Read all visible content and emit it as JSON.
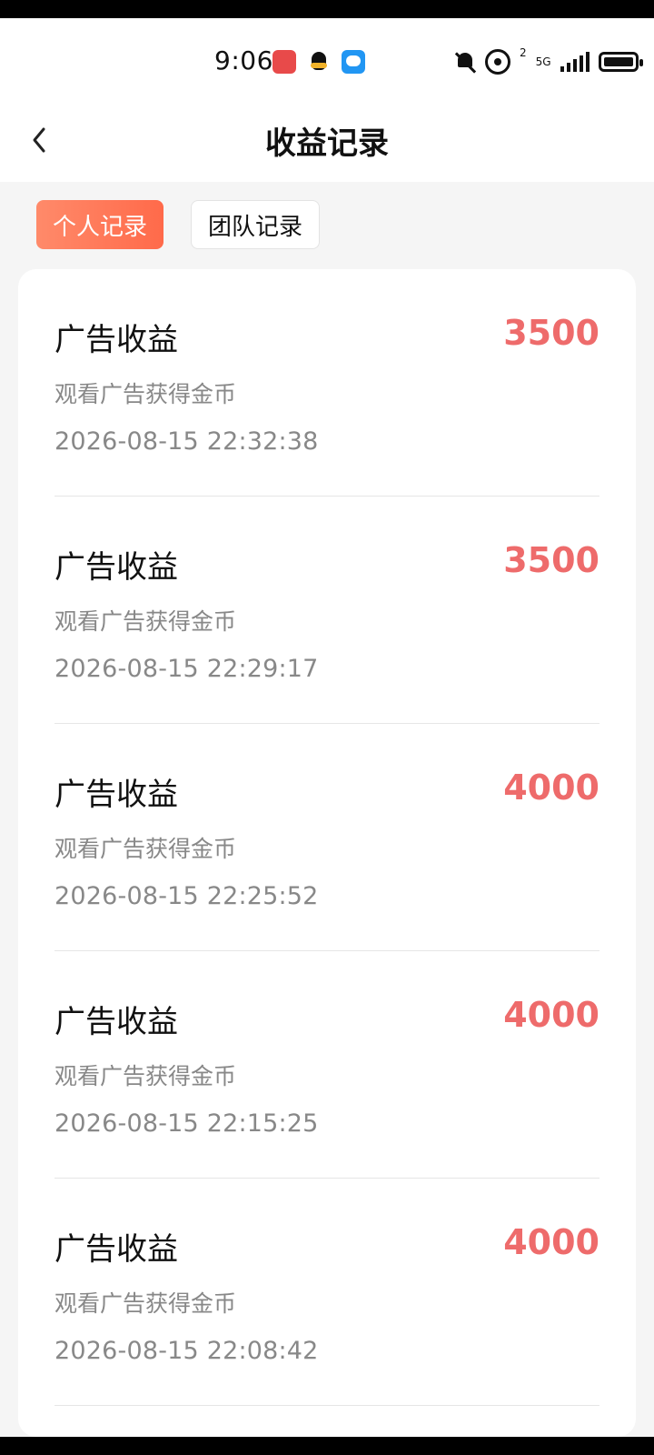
{
  "status_bar": {
    "time": "9:06",
    "hotspot_superscript": "2",
    "network_label": "5G"
  },
  "header": {
    "title": "收益记录"
  },
  "tabs": [
    {
      "label": "个人记录",
      "active": true
    },
    {
      "label": "团队记录",
      "active": false
    }
  ],
  "records": [
    {
      "title": "广告收益",
      "amount": "3500",
      "desc": "观看广告获得金币",
      "time": "2026-08-15 22:32:38"
    },
    {
      "title": "广告收益",
      "amount": "3500",
      "desc": "观看广告获得金币",
      "time": "2026-08-15 22:29:17"
    },
    {
      "title": "广告收益",
      "amount": "4000",
      "desc": "观看广告获得金币",
      "time": "2026-08-15 22:25:52"
    },
    {
      "title": "广告收益",
      "amount": "4000",
      "desc": "观看广告获得金币",
      "time": "2026-08-15 22:15:25"
    },
    {
      "title": "广告收益",
      "amount": "4000",
      "desc": "观看广告获得金币",
      "time": "2026-08-15 22:08:42"
    }
  ],
  "colors": {
    "amount": "#ee6b6b",
    "tab_active_start": "#ff8a6a",
    "tab_active_end": "#ff6a4a"
  }
}
